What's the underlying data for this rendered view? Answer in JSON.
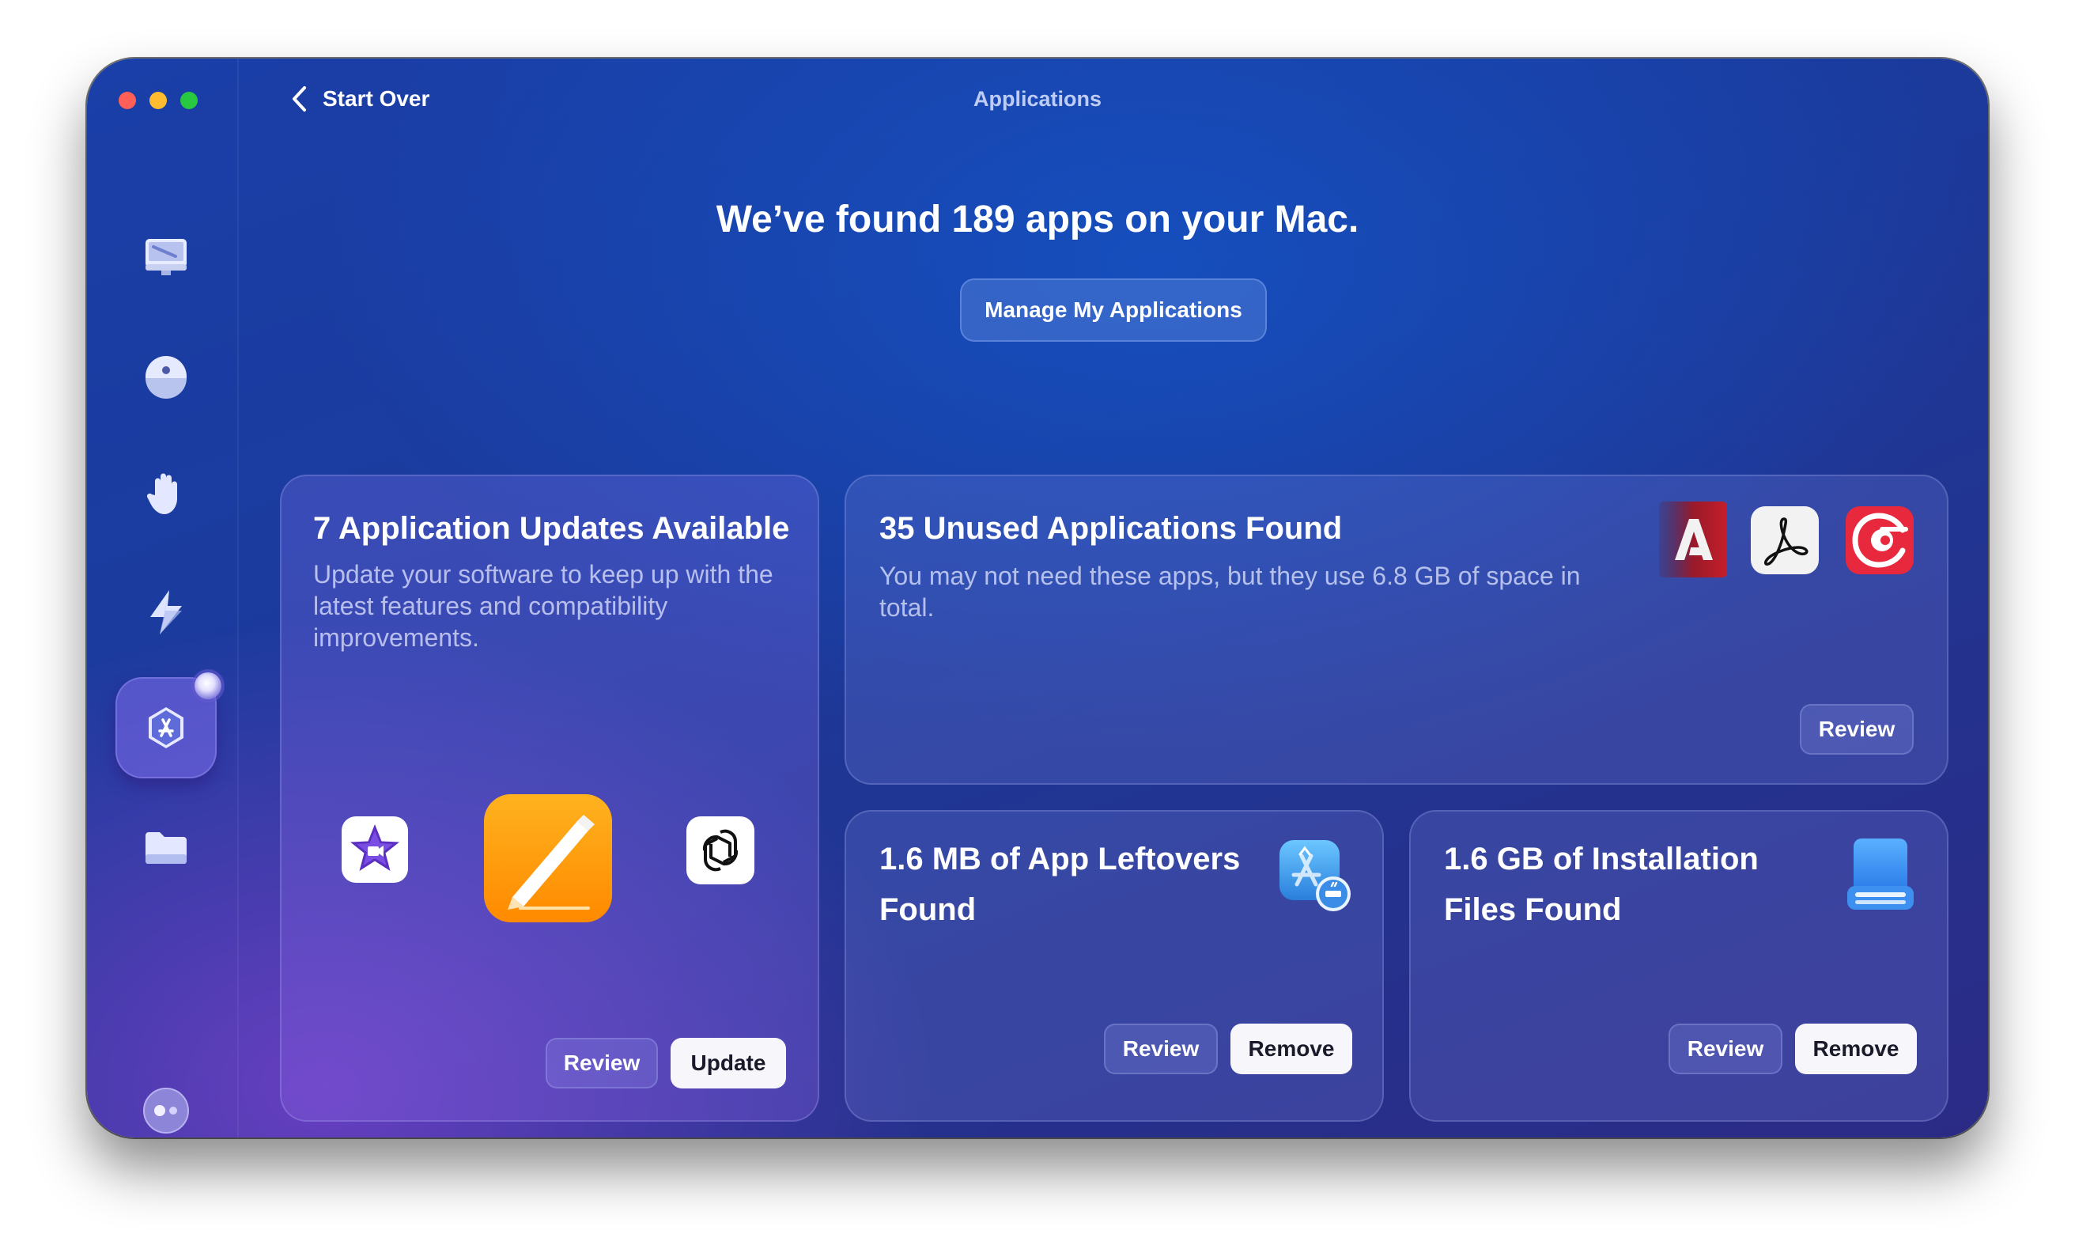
{
  "window": {
    "title": "Applications",
    "back_label": "Start Over"
  },
  "sidebar": {
    "items": [
      {
        "name": "cleanup",
        "icon": "monitor-icon"
      },
      {
        "name": "protection",
        "icon": "shield-ball-icon"
      },
      {
        "name": "privacy",
        "icon": "hand-icon"
      },
      {
        "name": "performance",
        "icon": "lightning-icon"
      },
      {
        "name": "applications",
        "icon": "app-store-icon",
        "active": true
      },
      {
        "name": "files",
        "icon": "folder-icon"
      },
      {
        "name": "assistant",
        "icon": "assistant-icon"
      }
    ]
  },
  "header": {
    "headline": "We’ve found 189 apps on your Mac.",
    "manage_label": "Manage My Applications"
  },
  "cards": {
    "updates": {
      "title": "7 Application Updates Available",
      "description": "Update your software to keep up with the latest features and compatibility improvements.",
      "apps": [
        "iMovie",
        "Pages",
        "ChatGPT"
      ],
      "review_label": "Review",
      "action_label": "Update"
    },
    "unused": {
      "title": "35 Unused Applications Found",
      "description": "You may not need these apps, but they use 6.8 GB of space in total.",
      "apps": [
        "Adobe Creative Cloud",
        "Adobe Acrobat Reader",
        "ExpressVPN"
      ],
      "review_label": "Review"
    },
    "leftovers": {
      "title": "1.6 MB of App Leftovers Found",
      "icon": "app-leftovers-icon",
      "review_label": "Review",
      "action_label": "Remove"
    },
    "installation": {
      "title": "1.6 GB of Installation Files Found",
      "icon": "installation-drive-icon",
      "review_label": "Review",
      "action_label": "Remove"
    }
  },
  "colors": {
    "accent": "#2b56c8",
    "sidebar_active": "#7d6eeb",
    "pages_orange": "#ff9f0a",
    "vpn_red": "#e8293d"
  }
}
